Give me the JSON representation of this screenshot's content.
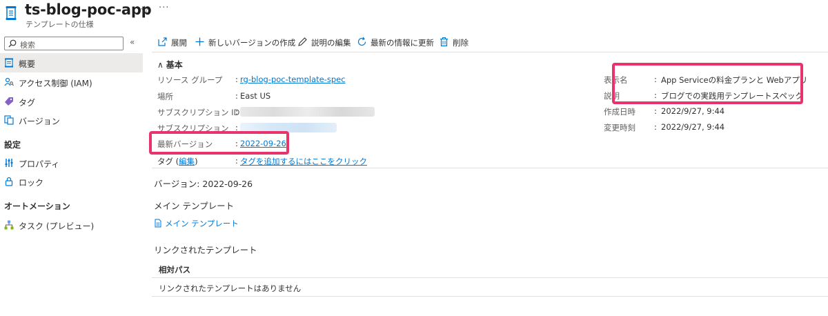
{
  "header": {
    "title": "ts-blog-poc-app",
    "subtitle": "テンプレートの仕様",
    "favorite_glyph": "☆",
    "more_glyph": "···",
    "icon": "template-spec-icon"
  },
  "sidebar": {
    "search_placeholder": "検索",
    "collapse_glyph": "«",
    "items": [
      {
        "label": "概要",
        "icon": "overview-icon",
        "active": true
      },
      {
        "label": "アクセス制御 (IAM)",
        "icon": "iam-icon"
      },
      {
        "label": "タグ",
        "icon": "tag-icon"
      },
      {
        "label": "バージョン",
        "icon": "versions-icon"
      }
    ],
    "section_settings": "設定",
    "settings_items": [
      {
        "label": "プロパティ",
        "icon": "properties-icon"
      },
      {
        "label": "ロック",
        "icon": "lock-icon"
      }
    ],
    "section_automation": "オートメーション",
    "automation_items": [
      {
        "label": "タスク (プレビュー)",
        "icon": "tasks-icon"
      }
    ]
  },
  "toolbar": {
    "deploy": "展開",
    "new_version": "新しいバージョンの作成",
    "edit_description": "説明の編集",
    "refresh": "最新の情報に更新",
    "delete": "削除"
  },
  "essentials": {
    "heading": "基本",
    "chevron": "∧",
    "resource_group_label": "リソース グループ",
    "resource_group_value": "rg-blog-poc-template-spec",
    "location_label": "場所",
    "location_value": "East US",
    "subscription_id_label": "サブスクリプション ID",
    "subscription_label": "サブスクリプション",
    "latest_version_label": "最新バージョン",
    "latest_version_value": "2022-09-26",
    "tags_label_prefix": "タグ (",
    "tags_edit": "編集",
    "tags_label_suffix": ")",
    "tags_value": "タグを追加するにはここをクリック",
    "display_name_label": "表示名",
    "display_name_value": "App Serviceの料金プランと Webアプリ",
    "description_label": "説明",
    "description_value": "ブログでの実践用テンプレートスペック",
    "created_label": "作成日時",
    "created_value": "2022/9/27, 9:44",
    "modified_label": "変更時刻",
    "modified_value": "2022/9/27, 9:44",
    "colon": ":"
  },
  "version_section": {
    "title": "バージョン: 2022-09-26",
    "main_template_heading": "メイン テンプレート",
    "main_template_link": "メイン テンプレート",
    "linked_templates_heading": "リンクされたテンプレート",
    "relative_path_header": "相対パス",
    "no_linked_templates": "リンクされたテンプレートはありません"
  },
  "colors": {
    "accent": "#0078d4",
    "highlight": "#e8336d",
    "text": "#323130",
    "muted": "#605e5c"
  }
}
